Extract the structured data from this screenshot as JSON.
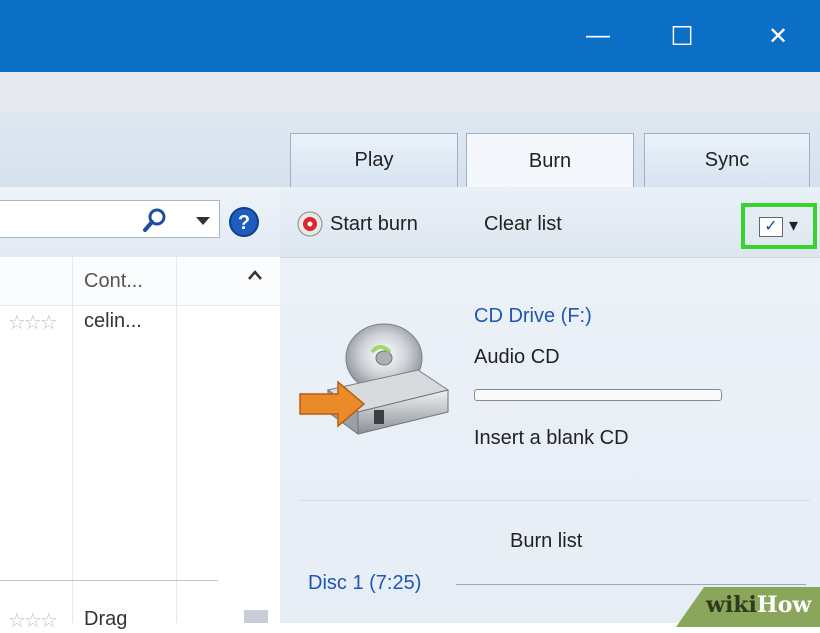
{
  "window": {
    "minimize_glyph": "—",
    "maximize_glyph": "☐",
    "close_glyph": "✕"
  },
  "tabs": [
    {
      "label": "Play"
    },
    {
      "label": "Burn"
    },
    {
      "label": "Sync"
    }
  ],
  "library": {
    "column_header": "Cont...",
    "rows": [
      {
        "rating": "☆☆☆",
        "contributor": "celin..."
      },
      {
        "rating": "☆☆☆",
        "contributor": "Drag"
      }
    ]
  },
  "burn_toolbar": {
    "start_burn_label": "Start burn",
    "clear_list_label": "Clear list",
    "options_check": "✓",
    "dropdown_arrow": "▾"
  },
  "drive": {
    "name": "CD Drive (F:)",
    "type": "Audio CD",
    "status": "Insert a blank CD",
    "progress": 0
  },
  "burn_list": {
    "title": "Burn list",
    "disc_label": "Disc 1 (7:25)"
  },
  "watermark": {
    "wiki": "wiki",
    "how": "How"
  },
  "colors": {
    "titlebar": "#0b6fc6",
    "highlight": "#39d42b",
    "link": "#1f57b5"
  }
}
